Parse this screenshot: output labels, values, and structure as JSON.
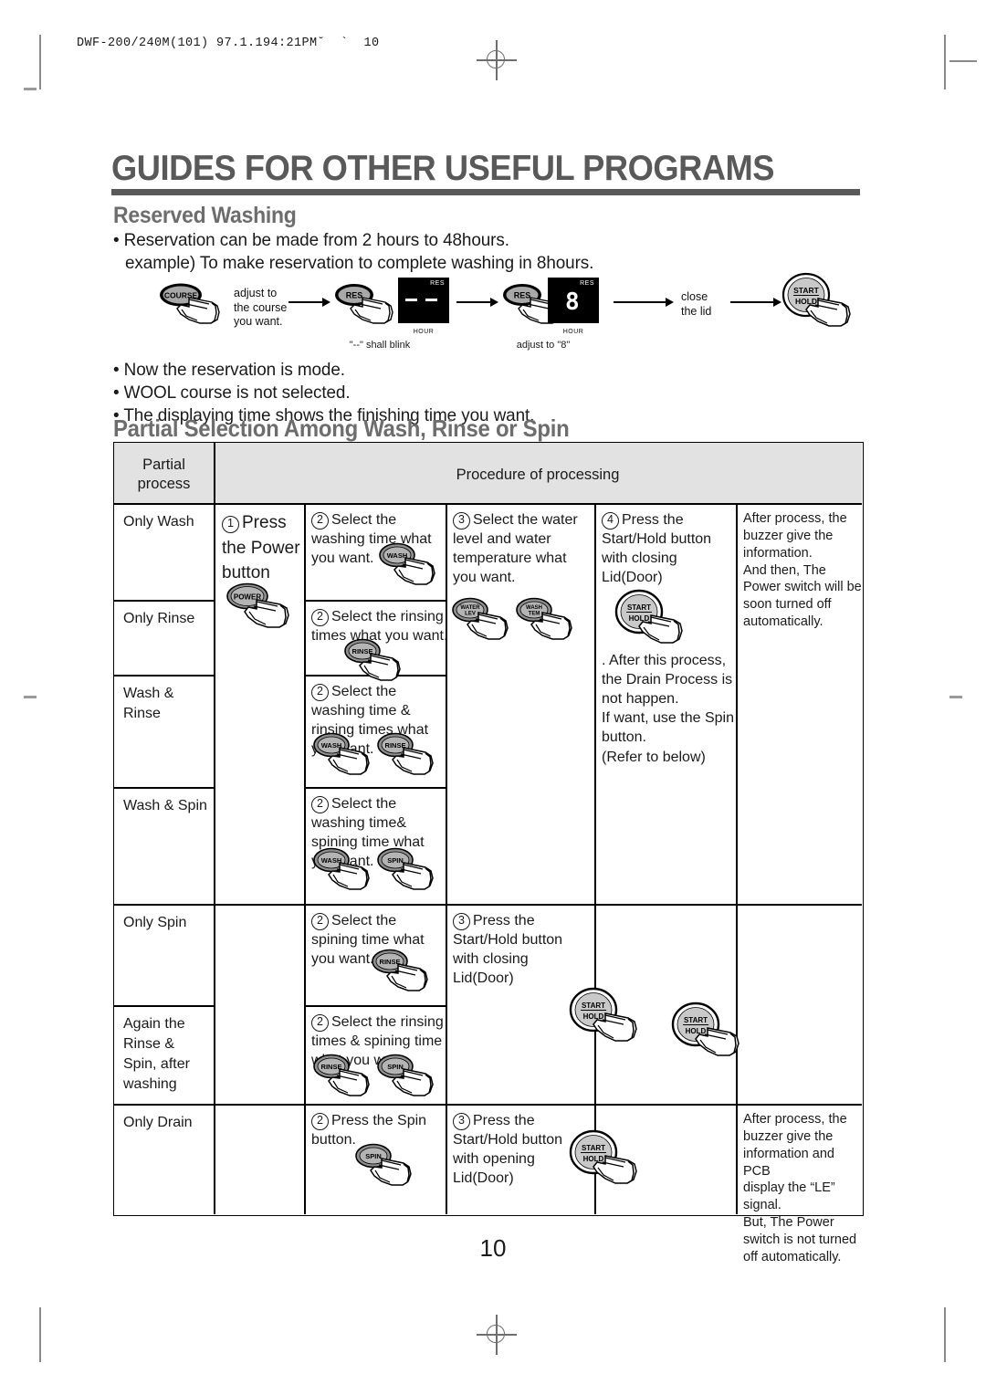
{
  "print_slug": "DWF-200/240M(101) 97.1.194:21PM˘  `  10",
  "page_title": "GUIDES FOR OTHER USEFUL PROGRAMS",
  "page_number": "10",
  "sections": [
    {
      "heading": "Reserved Washing",
      "bullets_top": [
        "• Reservation can be made from 2 hours to 48hours.",
        "example) To make reservation to complete washing in 8hours."
      ],
      "bullets_bottom": [
        "• Now the reservation is mode.",
        "• WOOL course is not selected.",
        "• The displaying time shows the finishing time you want."
      ],
      "flow": {
        "step1_button": "COURSE",
        "step1_caption": [
          "adjust to",
          "the course",
          "you want."
        ],
        "step2_button": "RES",
        "step2_caption": "\"--\" shall blink",
        "display1": {
          "res_label": "RES",
          "value": "--",
          "hour_label": "HOUR"
        },
        "step3_button": "RES",
        "step3_caption": "adjust to \"8\"",
        "display2": {
          "res_label": "RES",
          "value": "8",
          "hour_label": "HOUR"
        },
        "step4_caption": [
          "close",
          "the lid"
        ],
        "step5_button": [
          "START",
          "HOLD"
        ]
      }
    },
    {
      "heading": "Partial Selection Among Wash, Rinse or Spin"
    }
  ],
  "table": {
    "headers": {
      "col1": [
        "Partial",
        "process"
      ],
      "col2": "Procedure of processing"
    },
    "rows": [
      {
        "process": "Only Wash",
        "col2": {
          "num": "1",
          "text": [
            "Press",
            "the Power",
            "button"
          ],
          "button": "POWER"
        },
        "col3": {
          "num": "2",
          "text": [
            "Select the",
            "washing time what",
            "you want."
          ],
          "buttons": [
            "WASH"
          ]
        },
        "col4": {
          "num": "3",
          "text": [
            "Select the water",
            "level and water",
            "temperature what",
            "you want."
          ]
        },
        "col5": {
          "num": "4",
          "text": [
            "Press the",
            "Start/Hold button",
            "with closing",
            "Lid(Door)"
          ]
        },
        "col6": {
          "text": [
            "After process, the",
            "buzzer give the",
            "information.",
            "And then, The",
            "Power switch will be",
            "soon turned off",
            "automatically."
          ]
        }
      },
      {
        "process": "Only Rinse",
        "col3": {
          "num": "2",
          "text": [
            "Select the rinsing",
            "times what you want."
          ],
          "buttons": [
            "RINSE"
          ]
        }
      },
      {
        "process": "Wash &\nRinse",
        "col3": {
          "num": "2",
          "text": [
            "Select the",
            "washing time &",
            "rinsing times what",
            "you want."
          ],
          "buttons": [
            "WASH",
            "RINSE"
          ]
        }
      },
      {
        "process": "Wash & Spin",
        "col3": {
          "num": "2",
          "text": [
            "Select the",
            "washing time&",
            "spining time what",
            "you want."
          ],
          "buttons": [
            "WASH",
            "SPIN"
          ]
        }
      },
      {
        "process": "Only Spin",
        "col3": {
          "num": "2",
          "text": [
            "Select the",
            "spining time what",
            "you want."
          ],
          "buttons": [
            "RINSE"
          ]
        },
        "col4": {
          "num": "3",
          "text": [
            "Press the",
            "Start/Hold button",
            "with closing",
            "Lid(Door)"
          ]
        }
      },
      {
        "process": "Again the\nRinse &\nSpin, after\nwashing",
        "col3": {
          "num": "2",
          "text": [
            "Select the rinsing",
            "times & spining time",
            "what you want."
          ],
          "buttons": [
            "RINSE",
            "SPIN"
          ]
        }
      },
      {
        "process": "Only Drain",
        "col3": {
          "num": "2",
          "text": [
            "Press the Spin",
            "button."
          ],
          "buttons": [
            "SPIN"
          ]
        },
        "col4": {
          "num": "3",
          "text": [
            "Press the",
            "Start/Hold button",
            "with opening",
            "Lid(Door)"
          ]
        },
        "col6": {
          "text": [
            "After process, the",
            "buzzer give the",
            "information and PCB",
            "display the “LE”",
            "signal.",
            "But, The Power",
            "switch is not turned",
            "off automatically."
          ]
        }
      }
    ],
    "shared_col4_note": [
      ". After this process,",
      "the Drain Process is",
      "not happen.",
      "If want, use the Spin",
      "button.",
      "(Refer to below)"
    ],
    "shared_col4_buttons": [
      "WATER LEV",
      "WASH TEM"
    ],
    "shared_col5_button": [
      "START",
      "HOLD"
    ]
  },
  "row_labels": {
    "r1": "Only Wash",
    "r2": "Only Rinse",
    "r3a": "Wash &",
    "r3b": "Rinse",
    "r4": "Wash & Spin",
    "r5": "Only Spin",
    "r6a": "Again the",
    "r6b": "Rinse &",
    "r6c": "Spin, after",
    "r6d": "washing",
    "r7": "Only Drain"
  },
  "colors": {
    "heading_gray": "#595959",
    "header_fill": "#e2e2e2",
    "ink": "#1a1a1a"
  }
}
